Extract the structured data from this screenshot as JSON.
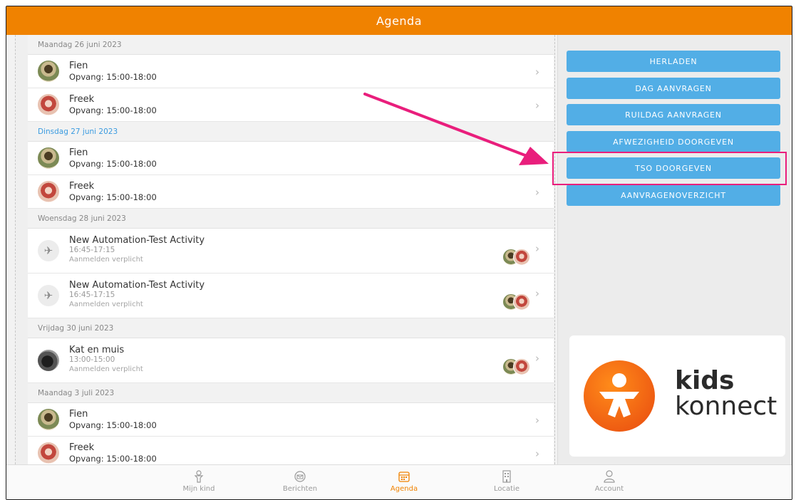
{
  "header": {
    "title": "Agenda"
  },
  "list": {
    "days": [
      {
        "label": "Maandag 26 juni 2023",
        "today": false,
        "items": [
          {
            "type": "child",
            "name": "Fien",
            "sub": "Opvang: 15:00-18:00",
            "avatar": "fien"
          },
          {
            "type": "child",
            "name": "Freek",
            "sub": "Opvang: 15:00-18:00",
            "avatar": "freek"
          }
        ]
      },
      {
        "label": "Dinsdag 27 juni 2023",
        "today": true,
        "items": [
          {
            "type": "child",
            "name": "Fien",
            "sub": "Opvang: 15:00-18:00",
            "avatar": "fien"
          },
          {
            "type": "child",
            "name": "Freek",
            "sub": "Opvang: 15:00-18:00",
            "avatar": "freek"
          }
        ]
      },
      {
        "label": "Woensdag 28 juni 2023",
        "today": false,
        "items": [
          {
            "type": "activity",
            "name": "New Automation-Test Activity",
            "time": "16:45-17:15",
            "note": "Aanmelden verplicht",
            "avatar": "activity"
          },
          {
            "type": "activity",
            "name": "New Automation-Test Activity",
            "time": "16:45-17:15",
            "note": "Aanmelden verplicht",
            "avatar": "activity"
          }
        ]
      },
      {
        "label": "Vrijdag 30 juni 2023",
        "today": false,
        "items": [
          {
            "type": "activity",
            "name": "Kat en muis",
            "time": "13:00-15:00",
            "note": "Aanmelden verplicht",
            "avatar": "cat"
          }
        ]
      },
      {
        "label": "Maandag 3 juli 2023",
        "today": false,
        "items": [
          {
            "type": "child",
            "name": "Fien",
            "sub": "Opvang: 15:00-18:00",
            "avatar": "fien"
          },
          {
            "type": "child",
            "name": "Freek",
            "sub": "Opvang: 15:00-18:00",
            "avatar": "freek"
          }
        ]
      }
    ]
  },
  "actions": {
    "buttons": [
      "HERLADEN",
      "DAG AANVRAGEN",
      "RUILDAG AANVRAGEN",
      "AFWEZIGHEID DOORGEVEN",
      "TSO DOORGEVEN",
      "AANVRAGENOVERZICHT"
    ],
    "highlighted": "TSO DOORGEVEN",
    "button_color": "#52aee6",
    "highlight_color": "#e91e7c"
  },
  "logo": {
    "line1": "kids",
    "line2": "konnect",
    "icon": "kidskonnect-logo-icon"
  },
  "nav": {
    "tabs": [
      {
        "label": "Mijn kind",
        "icon": "child-icon"
      },
      {
        "label": "Berichten",
        "icon": "messages-icon"
      },
      {
        "label": "Agenda",
        "icon": "calendar-icon",
        "active": true
      },
      {
        "label": "Locatie",
        "icon": "building-icon"
      },
      {
        "label": "Account",
        "icon": "user-icon"
      }
    ]
  },
  "colors": {
    "brand_orange": "#f08200",
    "today_blue": "#3a9be0",
    "annotation_arrow": "#e91e7c"
  }
}
